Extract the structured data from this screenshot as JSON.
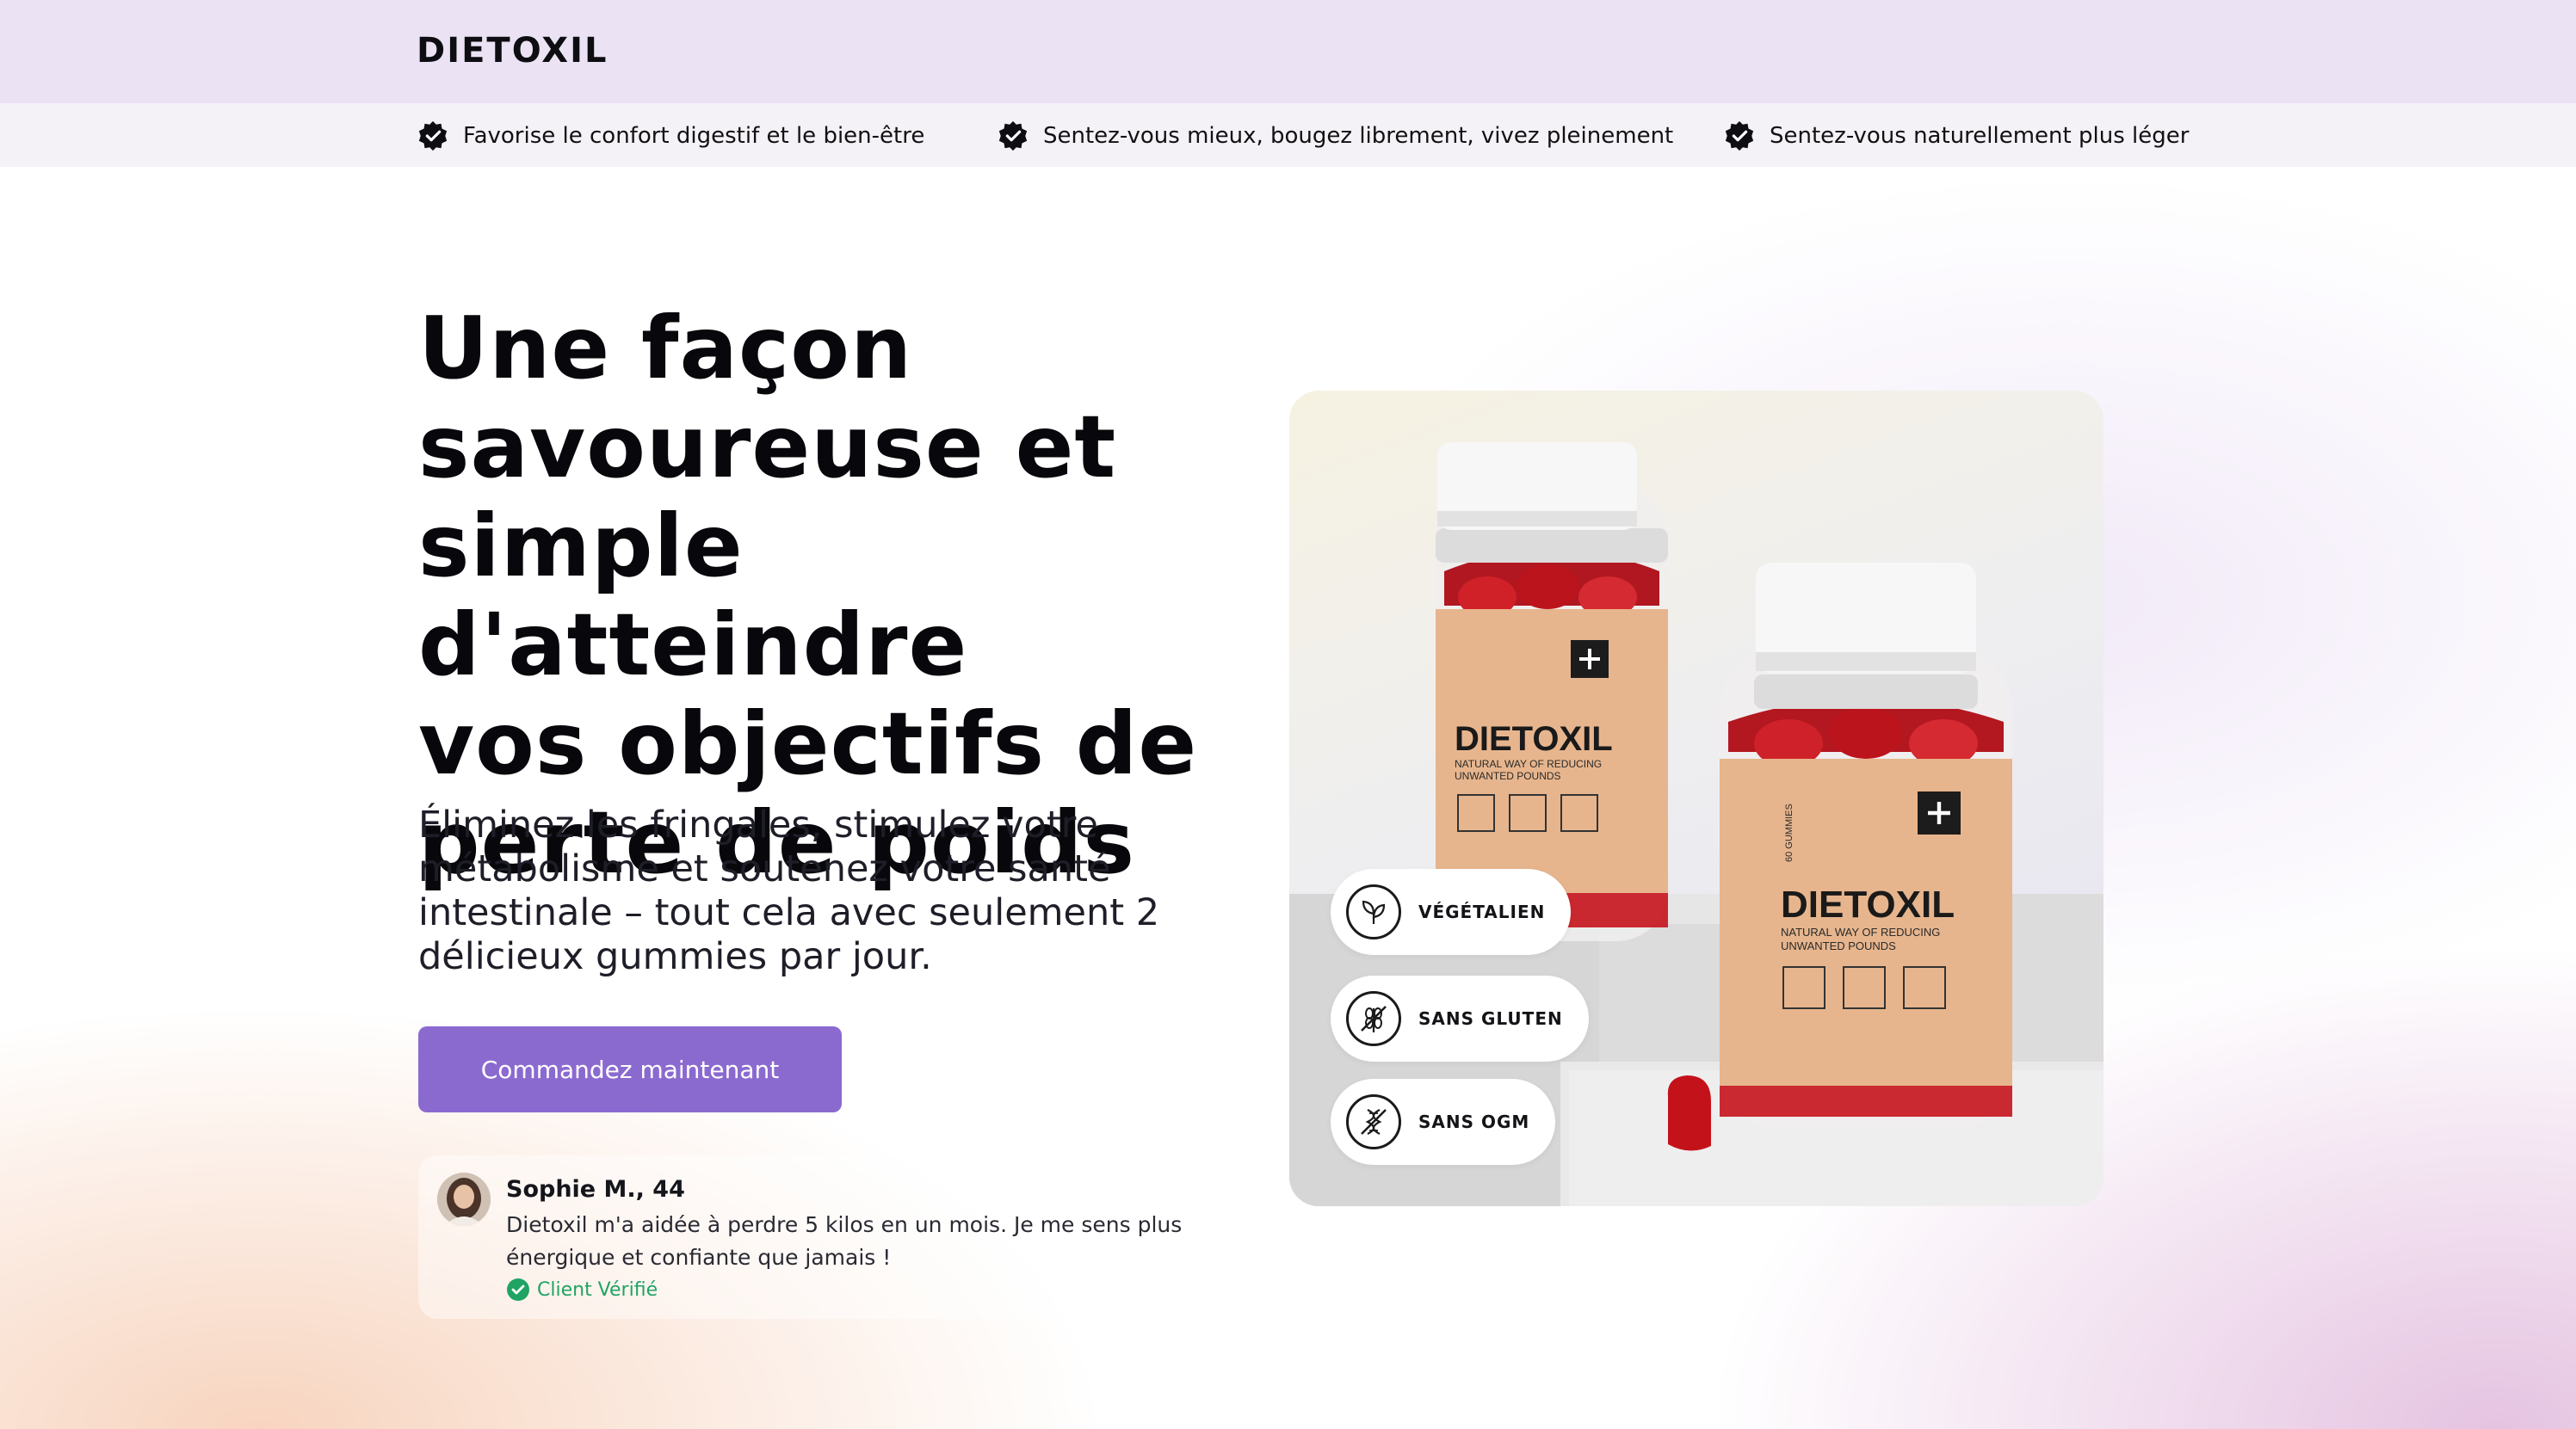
{
  "header": {
    "brand": "DIETOXIL"
  },
  "benefits": [
    {
      "label": "Favorise le confort digestif et le bien-être",
      "icon": "check-badge-icon"
    },
    {
      "label": "Sentez-vous mieux, bougez librement, vivez pleinement",
      "icon": "check-badge-icon"
    },
    {
      "label": "Sentez-vous naturellement plus léger",
      "icon": "check-badge-icon"
    }
  ],
  "hero": {
    "headline_lines": [
      "Une façon",
      "savoureuse et",
      "simple d'atteindre",
      "vos objectifs de",
      "perte de poids"
    ],
    "subhead": "Éliminez les fringales, stimulez votre métabolisme et soutenez votre santé intestinale – tout cela avec seulement 2 délicieux gummies par jour.",
    "cta_label": "Commandez maintenant"
  },
  "review": {
    "name": "Sophie M., 44",
    "text": "Dietoxil m'a aidée à perdre 5 kilos en un mois. Je me sens plus énergique et confiante que jamais !",
    "verified_label": "Client Vérifié"
  },
  "product": {
    "jar_brand": "DIETOXIL",
    "jar_tagline_1": "NATURAL WAY OF REDUCING",
    "jar_tagline_2": "UNWANTED POUNDS",
    "jar_count": "60 GUMMIES",
    "badges": [
      {
        "label": "VÉGÉTALIEN",
        "icon": "leaf-icon"
      },
      {
        "label": "SANS GLUTEN",
        "icon": "no-gluten-icon"
      },
      {
        "label": "SANS OGM",
        "icon": "no-gmo-icon"
      }
    ]
  },
  "colors": {
    "header_bg": "#ebe2f4",
    "cta_bg": "#8b6ad0",
    "verified": "#1fa463",
    "jar_label": "#e7b58d",
    "gummy": "#c4121b"
  }
}
